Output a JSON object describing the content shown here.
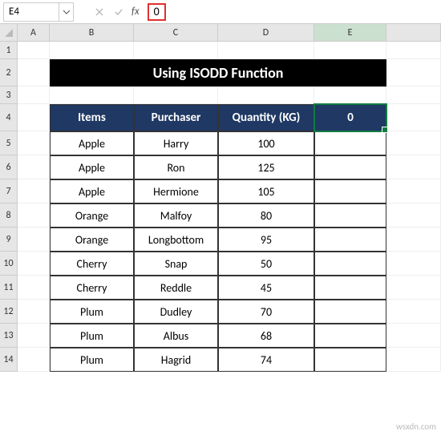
{
  "formula_bar": {
    "cell_ref": "E4",
    "fx_label": "fx",
    "value": "0"
  },
  "columns": [
    "A",
    "B",
    "C",
    "D",
    "E"
  ],
  "active_col": "E",
  "active_row": "4",
  "title": "Using ISODD Function",
  "headers": {
    "items": "Items",
    "purchaser": "Purchaser",
    "quantity": "Quantity (KG)",
    "extra": "0"
  },
  "rows": [
    {
      "n": "5",
      "items": "Apple",
      "purchaser": "Harry",
      "qty": "100"
    },
    {
      "n": "6",
      "items": "Apple",
      "purchaser": "Ron",
      "qty": "125"
    },
    {
      "n": "7",
      "items": "Apple",
      "purchaser": "Hermione",
      "qty": "105"
    },
    {
      "n": "8",
      "items": "Orange",
      "purchaser": "Malfoy",
      "qty": "80"
    },
    {
      "n": "9",
      "items": "Orange",
      "purchaser": "Longbottom",
      "qty": "95"
    },
    {
      "n": "10",
      "items": "Cherry",
      "purchaser": "Snap",
      "qty": "50"
    },
    {
      "n": "11",
      "items": "Cherry",
      "purchaser": "Reddle",
      "qty": "45"
    },
    {
      "n": "12",
      "items": "Plum",
      "purchaser": "Dudley",
      "qty": "70"
    },
    {
      "n": "13",
      "items": "Plum",
      "purchaser": "Albus",
      "qty": "68"
    },
    {
      "n": "14",
      "items": "Plum",
      "purchaser": "Hagrid",
      "qty": "74"
    }
  ],
  "watermark": "wsxdn.com"
}
